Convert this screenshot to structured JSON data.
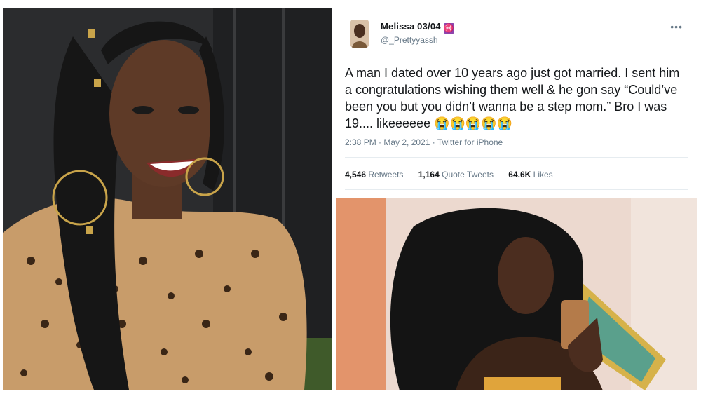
{
  "tweet": {
    "display_name": "Melissa 03/04",
    "zodiac_glyph": "♓",
    "handle": "@_Prettyyassh",
    "more_glyph": "•••",
    "text": "A man I dated over 10 years ago just got married. I sent him a congratulations wishing them well & he gon say “Could’ve been you but you didn’t wanna be a step mom.” Bro I was 19.... likeeeeee 😭😭😭😭😭",
    "meta": "2:38 PM · May 2, 2021 · Twitter for iPhone",
    "stats": [
      {
        "count": "4,546",
        "label": "Retweets"
      },
      {
        "count": "1,164",
        "label": "Quote Tweets"
      },
      {
        "count": "64.6K",
        "label": "Likes"
      }
    ]
  },
  "colors": {
    "text": "#14171a",
    "muted": "#657786",
    "divider": "#e6ecf0",
    "pisces_badge": "#8e44ad"
  }
}
